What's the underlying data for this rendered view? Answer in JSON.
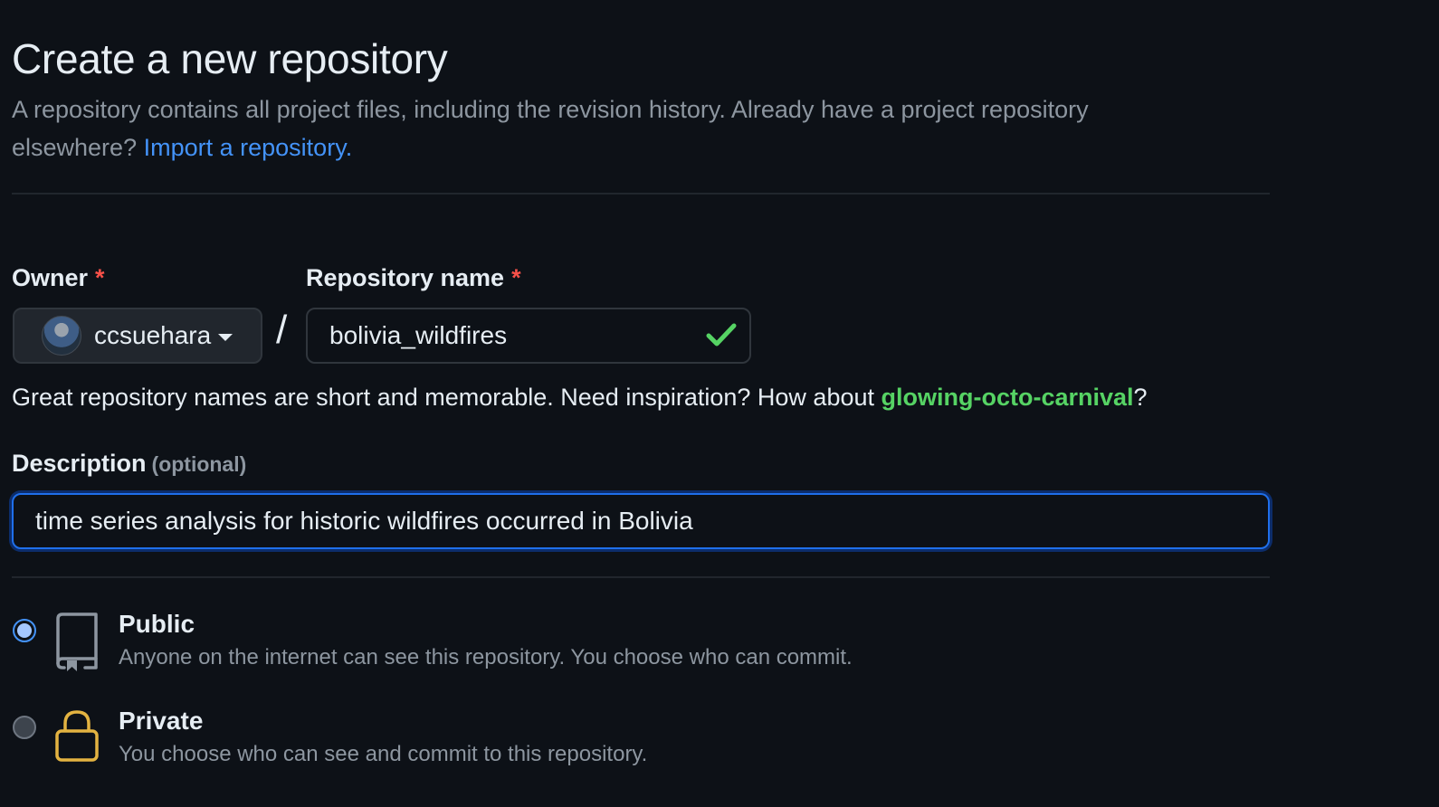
{
  "header": {
    "title": "Create a new repository",
    "subtitle": "A repository contains all project files, including the revision history. Already have a project repository elsewhere?",
    "import_link": "Import a repository."
  },
  "owner": {
    "label": "Owner",
    "required_mark": "*",
    "selected": "ccsuehara"
  },
  "separator": "/",
  "repo_name": {
    "label": "Repository name",
    "required_mark": "*",
    "value": "bolivia_wildfires",
    "valid": true
  },
  "hint": {
    "text": "Great repository names are short and memorable. Need inspiration? How about ",
    "suggestion": "glowing-octo-carnival",
    "suffix": "?"
  },
  "description": {
    "label": "Description",
    "optional": "(optional)",
    "value": "time series analysis for historic wildfires occurred in Bolivia"
  },
  "visibility": {
    "selected": "public",
    "public": {
      "title": "Public",
      "desc": "Anyone on the internet can see this repository. You choose who can commit.",
      "icon": "repo-icon"
    },
    "private": {
      "title": "Private",
      "desc": "You choose who can see and commit to this repository.",
      "icon": "lock-icon"
    }
  },
  "colors": {
    "background": "#0d1117",
    "link": "#4493f8",
    "required": "#f85149",
    "success": "#56d364",
    "lock": "#e3b341"
  }
}
